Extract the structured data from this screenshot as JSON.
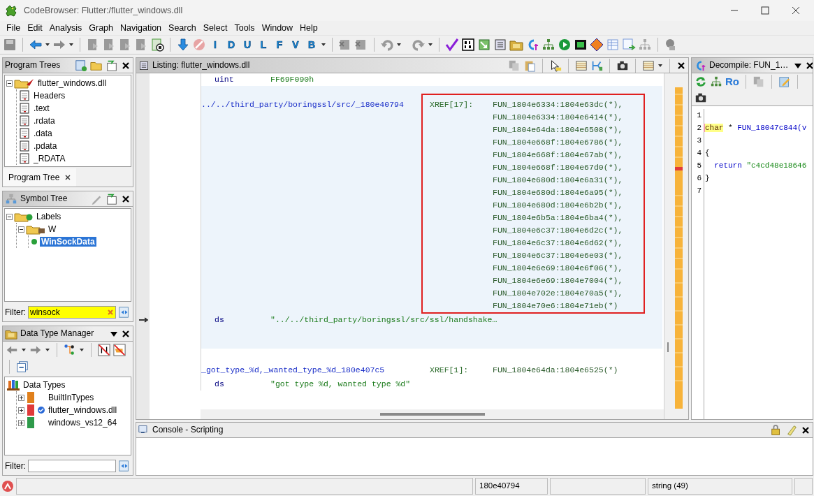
{
  "window": {
    "title": "CodeBrowser: Flutter:/flutter_windows.dll"
  },
  "menu": [
    "File",
    "Edit",
    "Analysis",
    "Graph",
    "Navigation",
    "Search",
    "Select",
    "Tools",
    "Window",
    "Help"
  ],
  "toolbar": {
    "letters": [
      "I",
      "D",
      "U",
      "L",
      "F",
      "V",
      "B"
    ]
  },
  "program_trees": {
    "title": "Program Trees",
    "tab": "Program Tree",
    "nodes": [
      {
        "label": "flutter_windows.dll",
        "kind": "program",
        "expanded": true,
        "selected": false,
        "children": [
          {
            "label": "Headers",
            "kind": "fragment",
            "selected": false
          },
          {
            "label": ".text",
            "kind": "fragment",
            "selected": false
          },
          {
            "label": ".rdata",
            "kind": "fragment",
            "selected": false
          },
          {
            "label": ".data",
            "kind": "fragment",
            "selected": false
          },
          {
            "label": ".pdata",
            "kind": "fragment",
            "selected": false
          },
          {
            "label": "_RDATA",
            "kind": "fragment",
            "selected": false
          }
        ]
      }
    ]
  },
  "symbol_tree": {
    "title": "Symbol Tree",
    "nodes": [
      {
        "label": "Labels",
        "kind": "labels",
        "expanded": true,
        "selected": false,
        "children": [
          {
            "label": "W",
            "kind": "namespace",
            "expanded": true,
            "selected": false,
            "children": [
              {
                "label": "WinSockData",
                "kind": "label",
                "selected": true
              }
            ]
          }
        ]
      }
    ],
    "filter": {
      "label": "Filter:",
      "value": "winsock"
    }
  },
  "data_type_manager": {
    "title": "Data Type Manager",
    "nodes": [
      {
        "label": "Data Types",
        "kind": "shelf",
        "selected": false,
        "children": [
          {
            "label": "BuiltInTypes",
            "kind": "book",
            "color": "#e0801c",
            "linked": false,
            "expanded": false,
            "selected": false
          },
          {
            "label": "flutter_windows.dll",
            "kind": "book",
            "color": "#e03a3a",
            "linked": true,
            "expanded": false,
            "selected": false
          },
          {
            "label": "windows_vs12_64",
            "kind": "book",
            "color": "#2e9a4a",
            "linked": false,
            "expanded": false,
            "selected": false
          }
        ]
      }
    ],
    "filter": {
      "label": "Filter:"
    }
  },
  "listing": {
    "title": "Listing:  flutter_windows.dll",
    "rows": [
      {
        "kind": "data",
        "mnemonic": "uint",
        "operand": "FF69F090h",
        "highlighted": false,
        "current": false
      },
      {
        "kind": "label",
        "label": "../../third_party/boringssl/src/_180e40794",
        "xref_label": "XREF[17]:",
        "boxed": true,
        "highlighted": true,
        "xrefs": [
          "FUN_1804e6334:1804e63dc(*),",
          "FUN_1804e6334:1804e6414(*),",
          "FUN_1804e64da:1804e6508(*),",
          "FUN_1804e668f:1804e6786(*),",
          "FUN_1804e668f:1804e67ab(*),",
          "FUN_1804e668f:1804e67d0(*),",
          "FUN_1804e680d:1804e6a31(*),",
          "FUN_1804e680d:1804e6a95(*),",
          "FUN_1804e680d:1804e6b2b(*),",
          "FUN_1804e6b5a:1804e6ba4(*),",
          "FUN_1804e6c37:1804e6d2c(*),",
          "FUN_1804e6c37:1804e6d62(*),",
          "FUN_1804e6c37:1804e6e03(*),",
          "FUN_1804e6e69:1804e6f06(*),",
          "FUN_1804e6e69:1804e7004(*),",
          "FUN_1804e702e:1804e70a5(*),",
          "FUN_1804e70e6:1804e71eb(*)"
        ]
      },
      {
        "kind": "data",
        "mnemonic": "ds",
        "operand": "\"../../third_party/boringssl/src/ssl/handshake…",
        "highlighted": true,
        "current": true
      },
      {
        "kind": "label",
        "label": "_got_type_%d,_wanted_type_%d_180e407c5",
        "xref_label": "XREF[1]:",
        "boxed": false,
        "highlighted": false,
        "xrefs": [
          "FUN_1804e64da:1804e6525(*)"
        ]
      },
      {
        "kind": "data",
        "mnemonic": "ds",
        "operand": "\"got type %d, wanted type %d\"",
        "highlighted": false,
        "current": false
      }
    ]
  },
  "decompile": {
    "title": "Decompile: FUN_1…",
    "toolbar_text": "Ro",
    "lines": [
      {
        "number": "1"
      },
      {
        "number": "2",
        "tokens": [
          {
            "text": "char",
            "kind": "type",
            "highlighted": true
          },
          {
            "text": " * ",
            "kind": "plain",
            "highlighted": false
          },
          {
            "text": "FUN_18047c844(v",
            "kind": "function",
            "highlighted": false
          }
        ]
      },
      {
        "number": "3"
      },
      {
        "number": "4",
        "tokens": [
          {
            "text": "{",
            "kind": "plain",
            "highlighted": false
          }
        ]
      },
      {
        "number": "5",
        "tokens": [
          {
            "text": "  return ",
            "kind": "keyword",
            "highlighted": false
          },
          {
            "text": "\"c4cd48e18646",
            "kind": "string",
            "highlighted": false
          }
        ]
      },
      {
        "number": "6",
        "tokens": [
          {
            "text": "}",
            "kind": "plain",
            "highlighted": false
          }
        ]
      },
      {
        "number": "7"
      }
    ]
  },
  "console": {
    "title": "Console - Scripting"
  },
  "status_bar": {
    "address": "180e40794",
    "data_type": "string (49)"
  }
}
